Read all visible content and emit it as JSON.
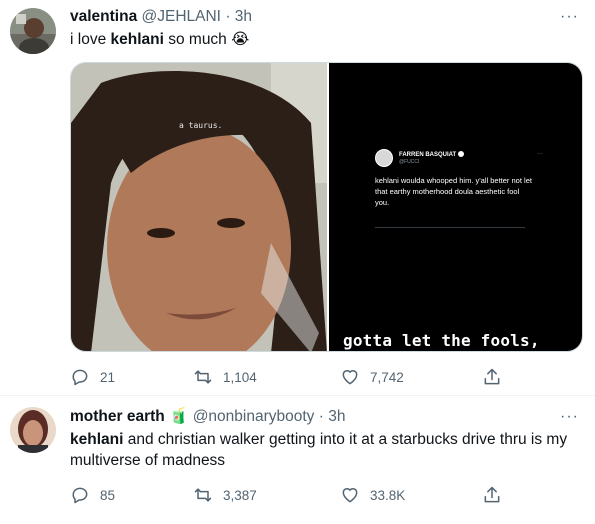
{
  "tweets": [
    {
      "name": "valentina",
      "handle": "@JEHLANI",
      "dot": "·",
      "time": "3h",
      "more": "···",
      "text_prefix": "i love ",
      "text_bold": "kehlani",
      "text_suffix": " so much ",
      "emoji": "😭",
      "media": {
        "left_caption": "a taurus.",
        "right_caption": "gotta let the fools,",
        "embedded_tweet": {
          "name": "FARREN BASQUIAT",
          "handle": "@FUCCI",
          "more": "···",
          "text": "kehlani woulda whooped him. y'all better not let that earthy motherhood doula aesthetic fool you."
        }
      },
      "replies": "21",
      "retweets": "1,104",
      "likes": "7,742"
    },
    {
      "name": "mother earth",
      "name_emoji": "🧃",
      "handle": "@nonbinarybooty",
      "dot": "·",
      "time": "3h",
      "more": "···",
      "text_bold": "kehlani",
      "text_rest": " and christian walker getting into it at a starbucks drive thru is my multiverse of madness",
      "replies": "85",
      "retweets": "3,387",
      "likes": "33.8K"
    }
  ],
  "icons": {
    "reply": "reply-icon",
    "retweet": "retweet-icon",
    "like": "heart-icon",
    "share": "share-icon",
    "more": "more-icon"
  },
  "colors": {
    "icon_gray": "#536471",
    "text": "#0f1419",
    "media_dark": "#000000"
  }
}
